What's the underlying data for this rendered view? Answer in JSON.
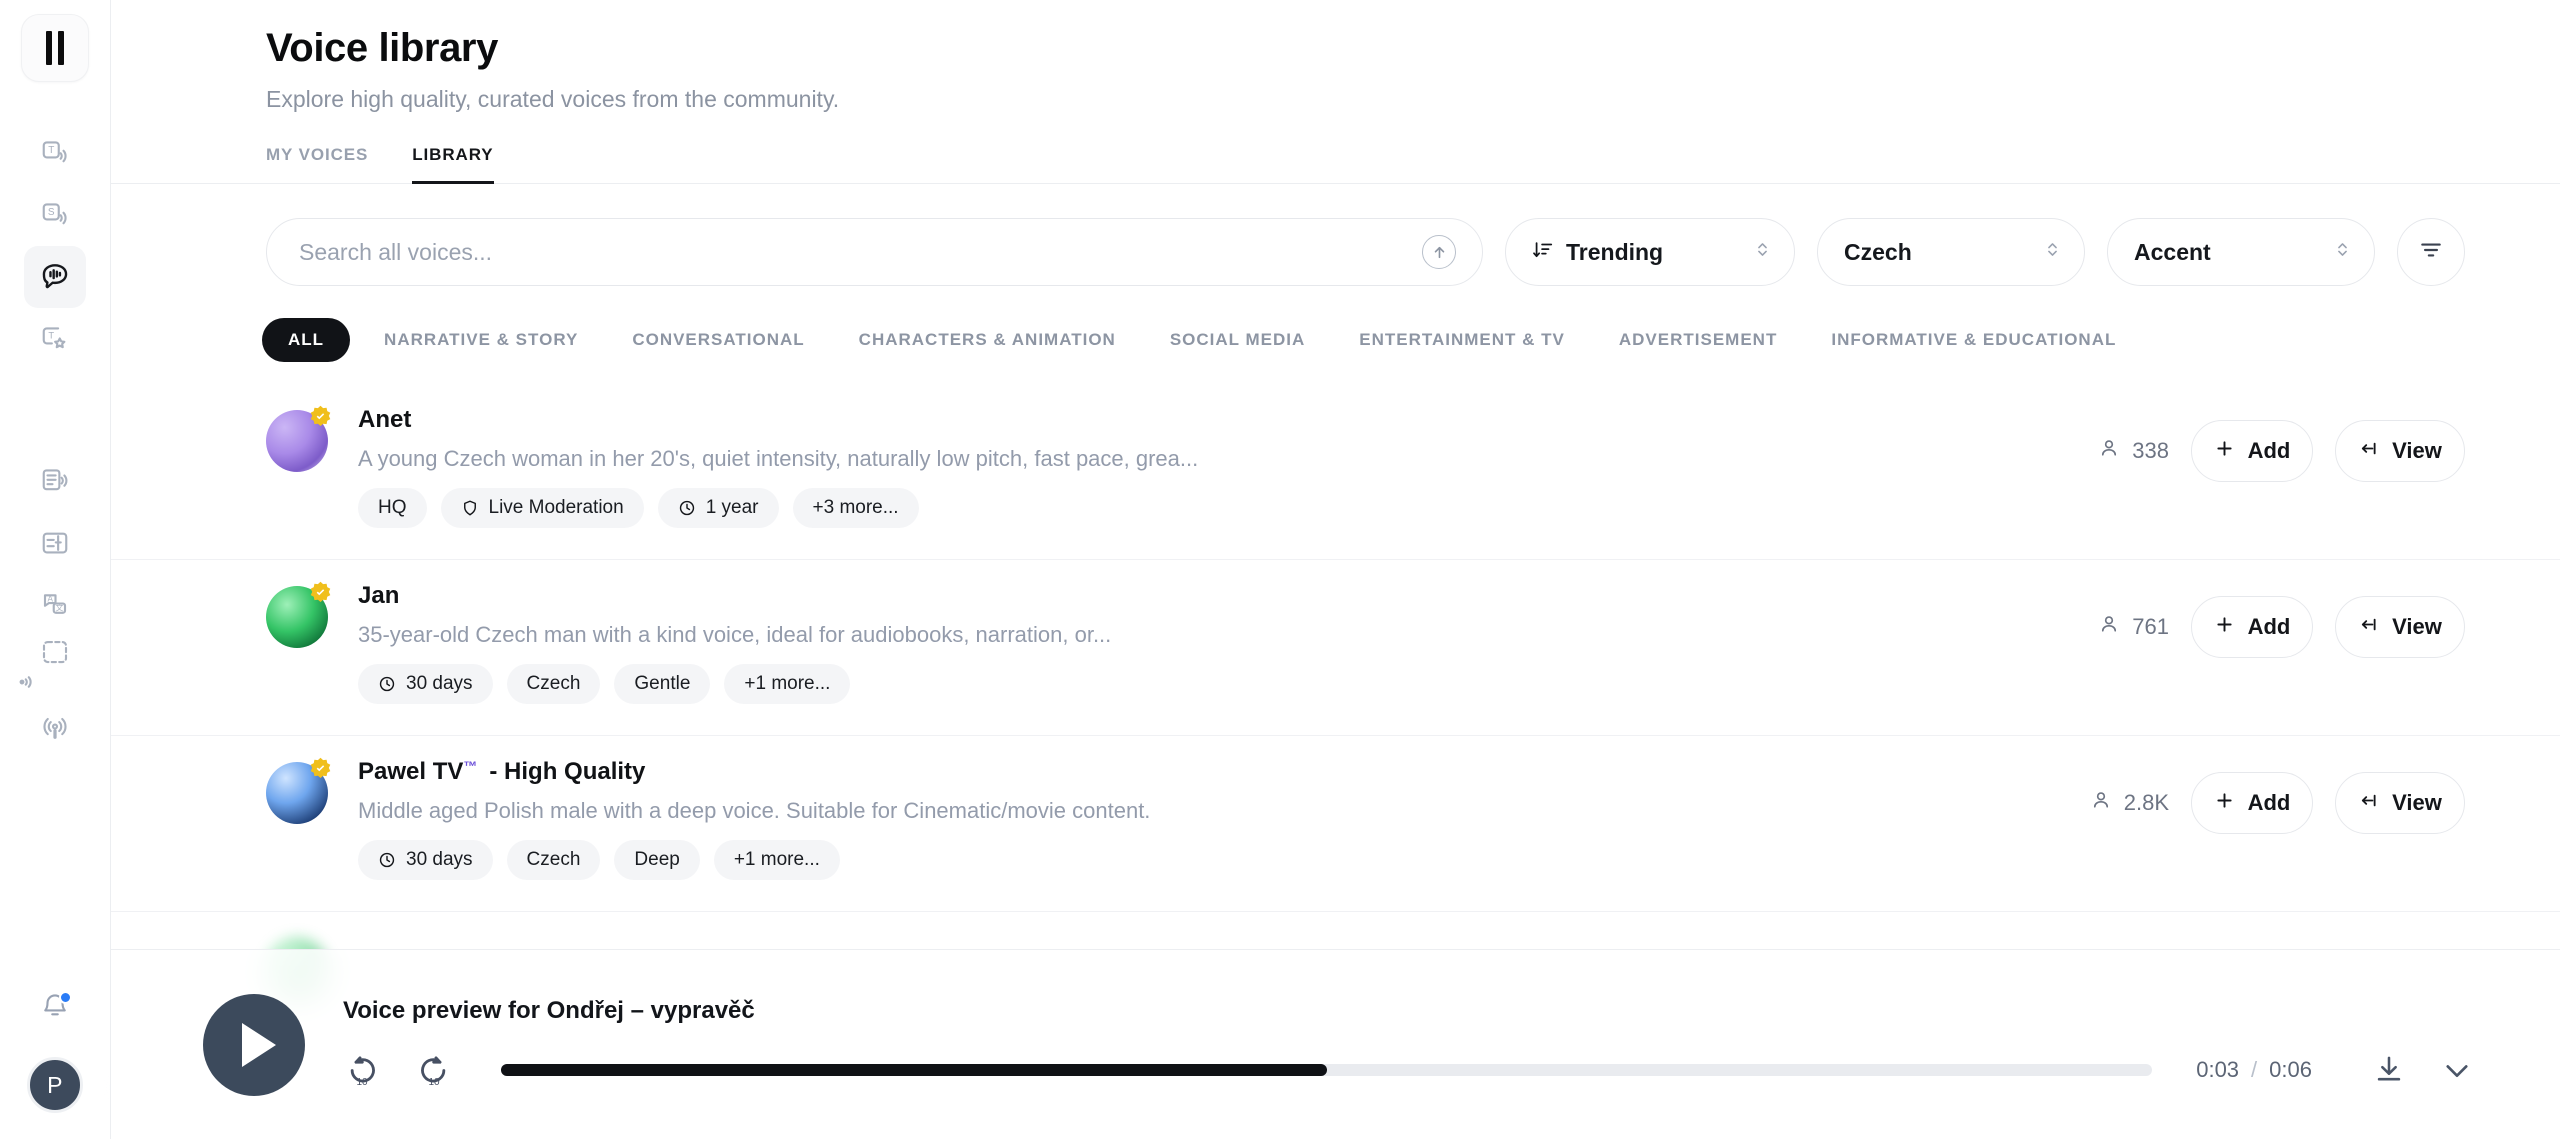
{
  "sidebar": {
    "logo_icon": "pause-logo-icon",
    "items_top": [
      {
        "icon": "text-to-speech-icon",
        "name": "sidebar-item-text-to-speech",
        "active": false
      },
      {
        "icon": "speech-to-speech-icon",
        "name": "sidebar-item-speech-to-speech",
        "active": false
      },
      {
        "icon": "voices-icon",
        "name": "sidebar-item-voices",
        "active": true
      },
      {
        "icon": "text-to-sfx-icon",
        "name": "sidebar-item-sound-design",
        "active": false
      }
    ],
    "items_mid": [
      {
        "icon": "audio-reader-icon",
        "name": "sidebar-item-reader",
        "active": false
      },
      {
        "icon": "studio-icon",
        "name": "sidebar-item-studio",
        "active": false
      },
      {
        "icon": "dubbing-translate-icon",
        "name": "sidebar-item-dubbing",
        "active": false
      },
      {
        "icon": "sound-effects-icon",
        "name": "sidebar-item-sound-effects",
        "active": false
      },
      {
        "icon": "podcast-icon",
        "name": "sidebar-item-podcast",
        "active": false
      }
    ],
    "bell_icon": "notification-bell-icon",
    "has_notification": true,
    "avatar_initial": "P"
  },
  "header": {
    "title": "Voice library",
    "subtitle": "Explore high quality, curated voices from the community.",
    "tabs": [
      {
        "label": "MY VOICES",
        "active": false
      },
      {
        "label": "LIBRARY",
        "active": true
      }
    ]
  },
  "search": {
    "placeholder": "Search all voices...",
    "value": "",
    "upload_icon": "upload-circle-icon",
    "sort": {
      "label": "Trending",
      "icon": "sort-desc-icon"
    },
    "language": {
      "label": "Czech"
    },
    "accent": {
      "label": "Accent"
    },
    "filter_icon": "filter-icon"
  },
  "categories": [
    {
      "label": "ALL",
      "active": true
    },
    {
      "label": "NARRATIVE & STORY",
      "active": false
    },
    {
      "label": "CONVERSATIONAL",
      "active": false
    },
    {
      "label": "CHARACTERS & ANIMATION",
      "active": false
    },
    {
      "label": "SOCIAL MEDIA",
      "active": false
    },
    {
      "label": "ENTERTAINMENT & TV",
      "active": false
    },
    {
      "label": "ADVERTISEMENT",
      "active": false
    },
    {
      "label": "INFORMATIVE & EDUCATIONAL",
      "active": false
    }
  ],
  "voices": [
    {
      "name": "Anet",
      "name_tm": "",
      "name_suffix": "",
      "verified": true,
      "description": "A young Czech woman in her 20's, quiet intensity, naturally low pitch, fast pace, grea...",
      "tags": [
        {
          "label": "HQ",
          "icon": ""
        },
        {
          "label": "Live Moderation",
          "icon": "shield-icon"
        },
        {
          "label": "1 year",
          "icon": "clock-icon"
        },
        {
          "label": "+3 more...",
          "icon": ""
        }
      ],
      "users": "338",
      "users_icon": "user-icon",
      "add_label": "Add",
      "add_icon": "plus-icon",
      "view_label": "View",
      "view_icon": "enter-arrow-icon"
    },
    {
      "name": "Jan",
      "name_tm": "",
      "name_suffix": "",
      "verified": true,
      "description": "35-year-old Czech man with a kind voice, ideal for audiobooks, narration, or...",
      "tags": [
        {
          "label": "30 days",
          "icon": "clock-icon"
        },
        {
          "label": "Czech",
          "icon": ""
        },
        {
          "label": "Gentle",
          "icon": ""
        },
        {
          "label": "+1 more...",
          "icon": ""
        }
      ],
      "users": "761",
      "users_icon": "user-icon",
      "add_label": "Add",
      "add_icon": "plus-icon",
      "view_label": "View",
      "view_icon": "enter-arrow-icon"
    },
    {
      "name": "Pawel TV",
      "name_tm": "™",
      "name_suffix": "- High Quality",
      "verified": true,
      "description": "Middle aged Polish male with a deep voice. Suitable for Cinematic/movie content.",
      "tags": [
        {
          "label": "30 days",
          "icon": "clock-icon"
        },
        {
          "label": "Czech",
          "icon": ""
        },
        {
          "label": "Deep",
          "icon": ""
        },
        {
          "label": "+1 more...",
          "icon": ""
        }
      ],
      "users": "2.8K",
      "users_icon": "user-icon",
      "add_label": "Add",
      "add_icon": "plus-icon",
      "view_label": "View",
      "view_icon": "enter-arrow-icon"
    }
  ],
  "player": {
    "play_icon": "play-icon",
    "title": "Voice preview for Ondřej – vypravěč",
    "rewind_label": "10",
    "forward_label": "10",
    "current_time": "0:03",
    "separator": "/",
    "total_time": "0:06",
    "progress_percent": 50,
    "download_icon": "download-icon",
    "collapse_icon": "chevron-down-icon"
  },
  "colors": {
    "accent_dark": "#111317",
    "notification_blue": "#2a7cf7",
    "verified_gold": "#f0bf1c",
    "muted_text": "#939bab",
    "player_button": "#3c4a5c"
  }
}
